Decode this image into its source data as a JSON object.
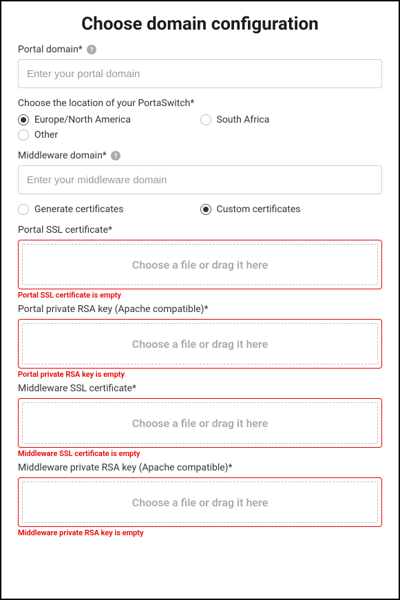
{
  "title": "Choose domain configuration",
  "portal_domain": {
    "label": "Portal domain*",
    "placeholder": "Enter your portal domain"
  },
  "location": {
    "label": "Choose the location of your PortaSwitch*",
    "options": {
      "europe_na": "Europe/North America",
      "south_africa": "South Africa",
      "other": "Other"
    },
    "selected": "europe_na"
  },
  "middleware_domain": {
    "label": "Middleware domain*",
    "placeholder": "Enter your middleware domain"
  },
  "cert_mode": {
    "options": {
      "generate": "Generate certificates",
      "custom": "Custom certificates"
    },
    "selected": "custom"
  },
  "dropzone_text": "Choose a file or drag it here",
  "uploads": {
    "portal_ssl": {
      "label": "Portal SSL certificate*",
      "error": "Portal SSL certificate is empty"
    },
    "portal_rsa": {
      "label": "Portal private RSA key (Apache compatible)*",
      "error": "Portal private RSA key is empty"
    },
    "middleware_ssl": {
      "label": "Middleware SSL certificate*",
      "error": "Middleware SSL certificate is empty"
    },
    "middleware_rsa": {
      "label": "Middleware private RSA key (Apache compatible)*",
      "error": "Middleware private RSA key is empty"
    }
  }
}
